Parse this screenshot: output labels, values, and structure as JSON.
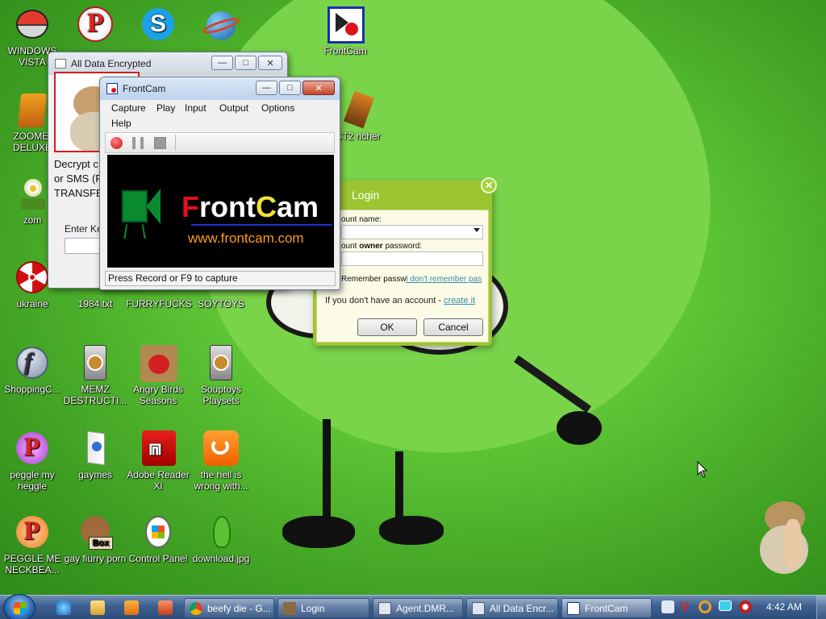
{
  "desktop_icons": [
    {
      "label": "WINDOWS VISTA",
      "icon": "pokeball-icon"
    },
    {
      "label": "",
      "icon": "peggle-p-icon"
    },
    {
      "label": "",
      "icon": "skype-icon"
    },
    {
      "label": "",
      "icon": "globe-app-icon"
    },
    {
      "label": "FrontCam",
      "icon": "frontcam-icon"
    },
    {
      "label": "ZOOMEI DELUXE",
      "icon": "zoombinis-icon"
    },
    {
      "label": "nRCT2 ncher",
      "icon": "rct2-icon"
    },
    {
      "label": "zom",
      "icon": "plant-icon"
    },
    {
      "label": "ukraine",
      "icon": "radiation-icon"
    },
    {
      "label": "1984.txt",
      "icon": "text-file-icon"
    },
    {
      "label": "FURRYFUCKS",
      "icon": "file-icon"
    },
    {
      "label": "SOYTOYS",
      "icon": "file-icon"
    },
    {
      "label": "ShoppingC...",
      "icon": "flash-icon"
    },
    {
      "label": "MEMZ DESTRUCTI...",
      "icon": "memz-icon"
    },
    {
      "label": "Angry Birds Seasons",
      "icon": "angry-birds-icon"
    },
    {
      "label": "Souptoys Playsets",
      "icon": "souptoys-icon"
    },
    {
      "label": "peggle my heggle",
      "icon": "peggle-icon"
    },
    {
      "label": "gaymes",
      "icon": "games-folder-icon"
    },
    {
      "label": "Adobe Reader XI",
      "icon": "adobe-reader-icon"
    },
    {
      "label": "the hell is wrong with...",
      "icon": "uc-browser-icon"
    },
    {
      "label": "PEGGLE ME NECKBEA...",
      "icon": "peggle-icon"
    },
    {
      "label": "gay fiurry porn",
      "icon": "bonzi-box-icon"
    },
    {
      "label": "Control Panel",
      "icon": "control-panel-icon"
    },
    {
      "label": "download.jpg",
      "icon": "image-file-icon"
    }
  ],
  "ade_window": {
    "title": "All Data Encrypted",
    "lines": [
      "Decrypt c",
      "or SMS (F",
      "TRANSFE"
    ],
    "key_label": "Enter Ke"
  },
  "frontcam_window": {
    "title": "FrontCam",
    "menu": [
      "Capture",
      "Play",
      "Input",
      "Output",
      "Options",
      "Help"
    ],
    "logo_f": "F",
    "logo_ront": "ront",
    "logo_c": "C",
    "logo_am": "am",
    "url": "www.frontcam.com",
    "status": "Press Record or F9 to capture"
  },
  "login_window": {
    "title": "Login",
    "account_label": "ount name:",
    "owner_pre": "ount ",
    "owner_bold": "owner",
    "owner_post": " password:",
    "remember": "Remember passw",
    "forgot_link": "I don't remember pas",
    "no_account": "If you don't have an account - ",
    "create_link": "create it",
    "ok": "OK",
    "cancel": "Cancel"
  },
  "taskbar": {
    "buttons": [
      {
        "label": "beefy die - G...",
        "icon": "chrome-icon"
      },
      {
        "label": "Login",
        "icon": "login-icon"
      },
      {
        "label": "Agent.DMR...",
        "icon": "window-icon"
      },
      {
        "label": "All Data Encr...",
        "icon": "window-icon"
      },
      {
        "label": "FrontCam",
        "icon": "frontcam-icon"
      }
    ],
    "clock": "4:42 AM"
  },
  "colors": {
    "taskbar": "#3c5f8f",
    "login_border": "#9cc631",
    "frontcam_red": "#e0101a",
    "frontcam_yellow": "#f4e13a",
    "frontcam_orange": "#ff9a1a"
  }
}
